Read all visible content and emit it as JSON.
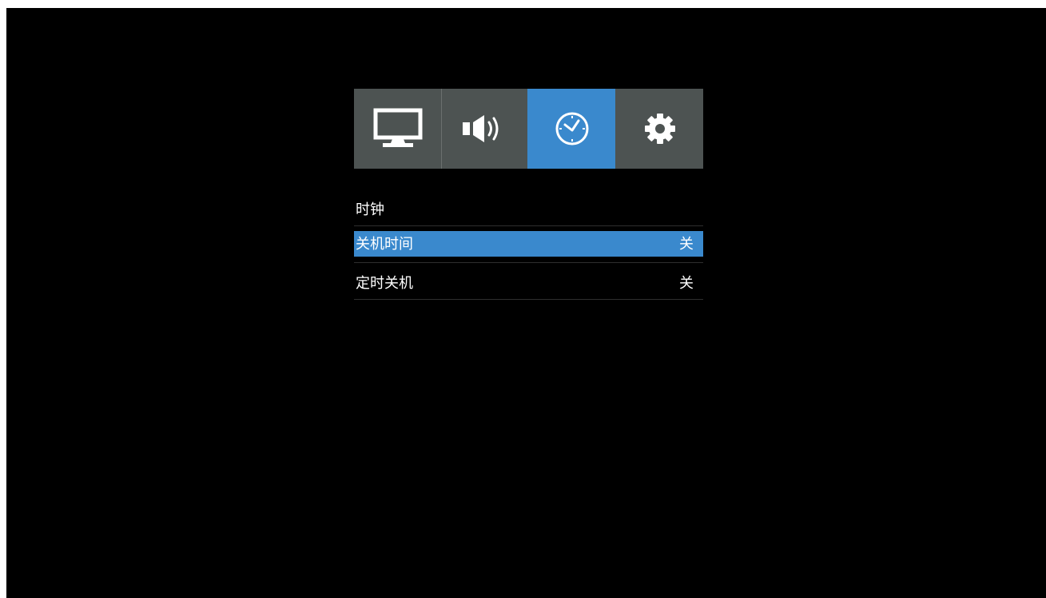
{
  "tabs": [
    {
      "icon": "monitor-icon",
      "active": false
    },
    {
      "icon": "speaker-icon",
      "active": false
    },
    {
      "icon": "clock-icon",
      "active": true
    },
    {
      "icon": "gear-icon",
      "active": false
    }
  ],
  "menu": {
    "items": [
      {
        "label": "时钟",
        "value": ""
      },
      {
        "label": "关机时间",
        "value": "关",
        "selected": true
      },
      {
        "label": "定时关机",
        "value": "关"
      }
    ]
  },
  "colors": {
    "accent": "#3a89cd",
    "tab_background": "#4d5352",
    "background": "#000000",
    "text": "#ffffff"
  }
}
